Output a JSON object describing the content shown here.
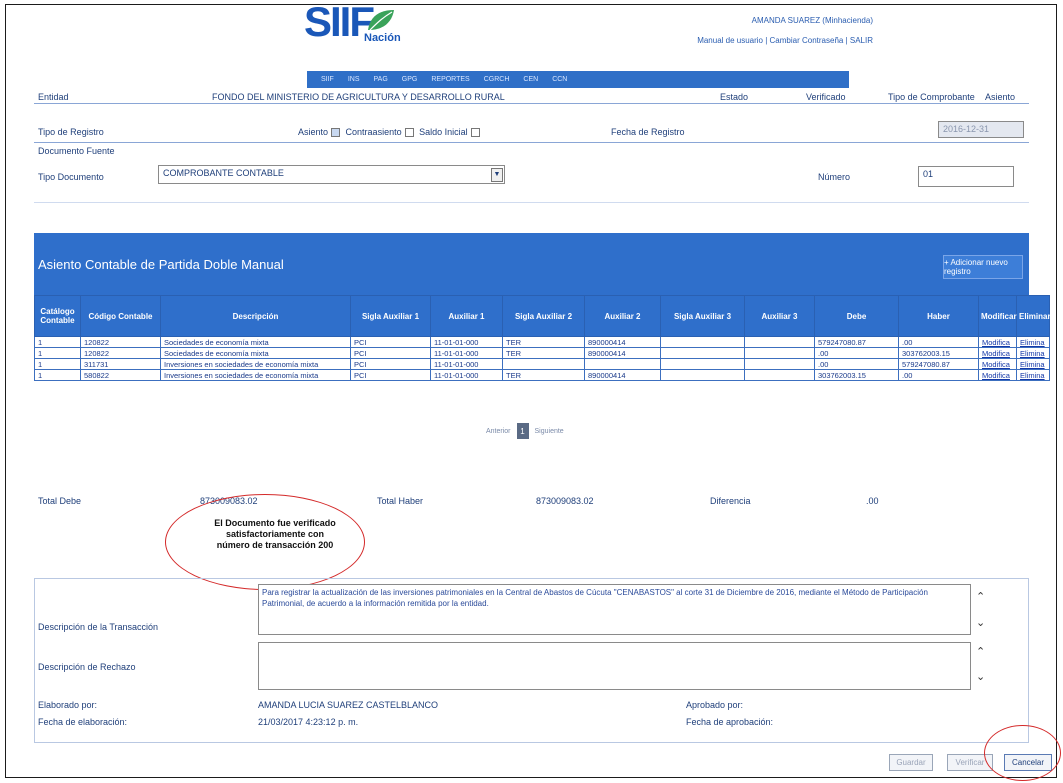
{
  "header": {
    "logo": "SIIF",
    "logo_sub": "Nación",
    "user": "AMANDA SUAREZ (Minhacienda)",
    "links": "Manual de usuario | Cambiar Contraseña | SALIR",
    "nav": [
      "SIIF",
      "INS",
      "PAG",
      "GPG",
      "REPORTES",
      "CGRCH",
      "CEN",
      "CCN"
    ]
  },
  "entity_row": {
    "entidad_label": "Entidad",
    "entidad_value": "FONDO DEL MINISTERIO DE AGRICULTURA Y DESARROLLO RURAL",
    "estado_label": "Estado",
    "estado_value": "Verificado",
    "tipo_comp_label": "Tipo de Comprobante",
    "tipo_comp_value": "Asiento"
  },
  "registro_row": {
    "tipo_registro_label": "Tipo de Registro",
    "asiento_label": "Asiento",
    "contraasiento_label": "Contraasiento",
    "saldo_inicial_label": "Saldo Inicial",
    "fecha_registro_label": "Fecha de Registro",
    "fecha_registro_value": "2016-12-31"
  },
  "documento": {
    "section_label": "Documento Fuente",
    "tipo_label": "Tipo Documento",
    "tipo_value": "COMPROBANTE CONTABLE",
    "numero_label": "Número",
    "numero_value": "01"
  },
  "panel": {
    "title": "Asiento Contable de Partida Doble Manual",
    "add_button": "+ Adicionar nuevo registro"
  },
  "table": {
    "headers": [
      "Catálogo Contable",
      "Código Contable",
      "Descripción",
      "Sigla Auxiliar 1",
      "Auxiliar 1",
      "Sigla Auxiliar 2",
      "Auxiliar 2",
      "Sigla Auxiliar 3",
      "Auxiliar 3",
      "Debe",
      "Haber",
      "Modificar",
      "Eliminar"
    ],
    "rows": [
      [
        "1",
        "120822",
        "Sociedades de economía mixta",
        "PCI",
        "11-01-01-000",
        "TER",
        "890000414",
        "",
        "",
        "579247080.87",
        ".00",
        "Modifica",
        "Elimina"
      ],
      [
        "1",
        "120822",
        "Sociedades de economía mixta",
        "PCI",
        "11-01-01-000",
        "TER",
        "890000414",
        "",
        "",
        ".00",
        "303762003.15",
        "Modifica",
        "Elimina"
      ],
      [
        "1",
        "311731",
        "Inversiones en sociedades de economía mixta",
        "PCI",
        "11-01-01-000",
        "",
        "",
        "",
        "",
        ".00",
        "579247080.87",
        "Modifica",
        "Elimina"
      ],
      [
        "1",
        "580822",
        "Inversiones en sociedades de economía mixta",
        "PCI",
        "11-01-01-000",
        "TER",
        "890000414",
        "",
        "",
        "303762003.15",
        ".00",
        "Modifica",
        "Elimina"
      ]
    ]
  },
  "pager": {
    "prev": "Anterior",
    "current": "1",
    "next": "Siguiente"
  },
  "totals": {
    "debe_label": "Total Debe",
    "debe_value": "873009083.02",
    "haber_label": "Total Haber",
    "haber_value": "873009083.02",
    "diff_label": "Diferencia",
    "diff_value": ".00"
  },
  "message": "El Documento fue verificado satisfactoriamente con número de transacción 200",
  "description": {
    "trans_label": "Descripción de la Transacción",
    "trans_value": "Para registrar la actualización de las inversiones patrimoniales en la Central de Abastos de Cúcuta \"CENABASTOS\" al corte 31 de Diciembre de 2016, mediante el Método de Participación Patrimonial, de acuerdo a la información remitida por la entidad.",
    "rechazo_label": "Descripción de Rechazo",
    "rechazo_value": "",
    "elaborado_label": "Elaborado por:",
    "elaborado_value": "AMANDA LUCIA SUAREZ CASTELBLANCO",
    "fecha_elab_label": "Fecha de elaboración:",
    "fecha_elab_value": "21/03/2017 4:23:12 p. m.",
    "aprobado_label": "Aprobado por:",
    "fecha_aprob_label": "Fecha de aprobación:"
  },
  "buttons": {
    "guardar": "Guardar",
    "verificar": "Verificar",
    "cancelar": "Cancelar"
  },
  "colors": {
    "panel_blue": "#2f6fcb",
    "highlight_red": "#d42a2a"
  }
}
